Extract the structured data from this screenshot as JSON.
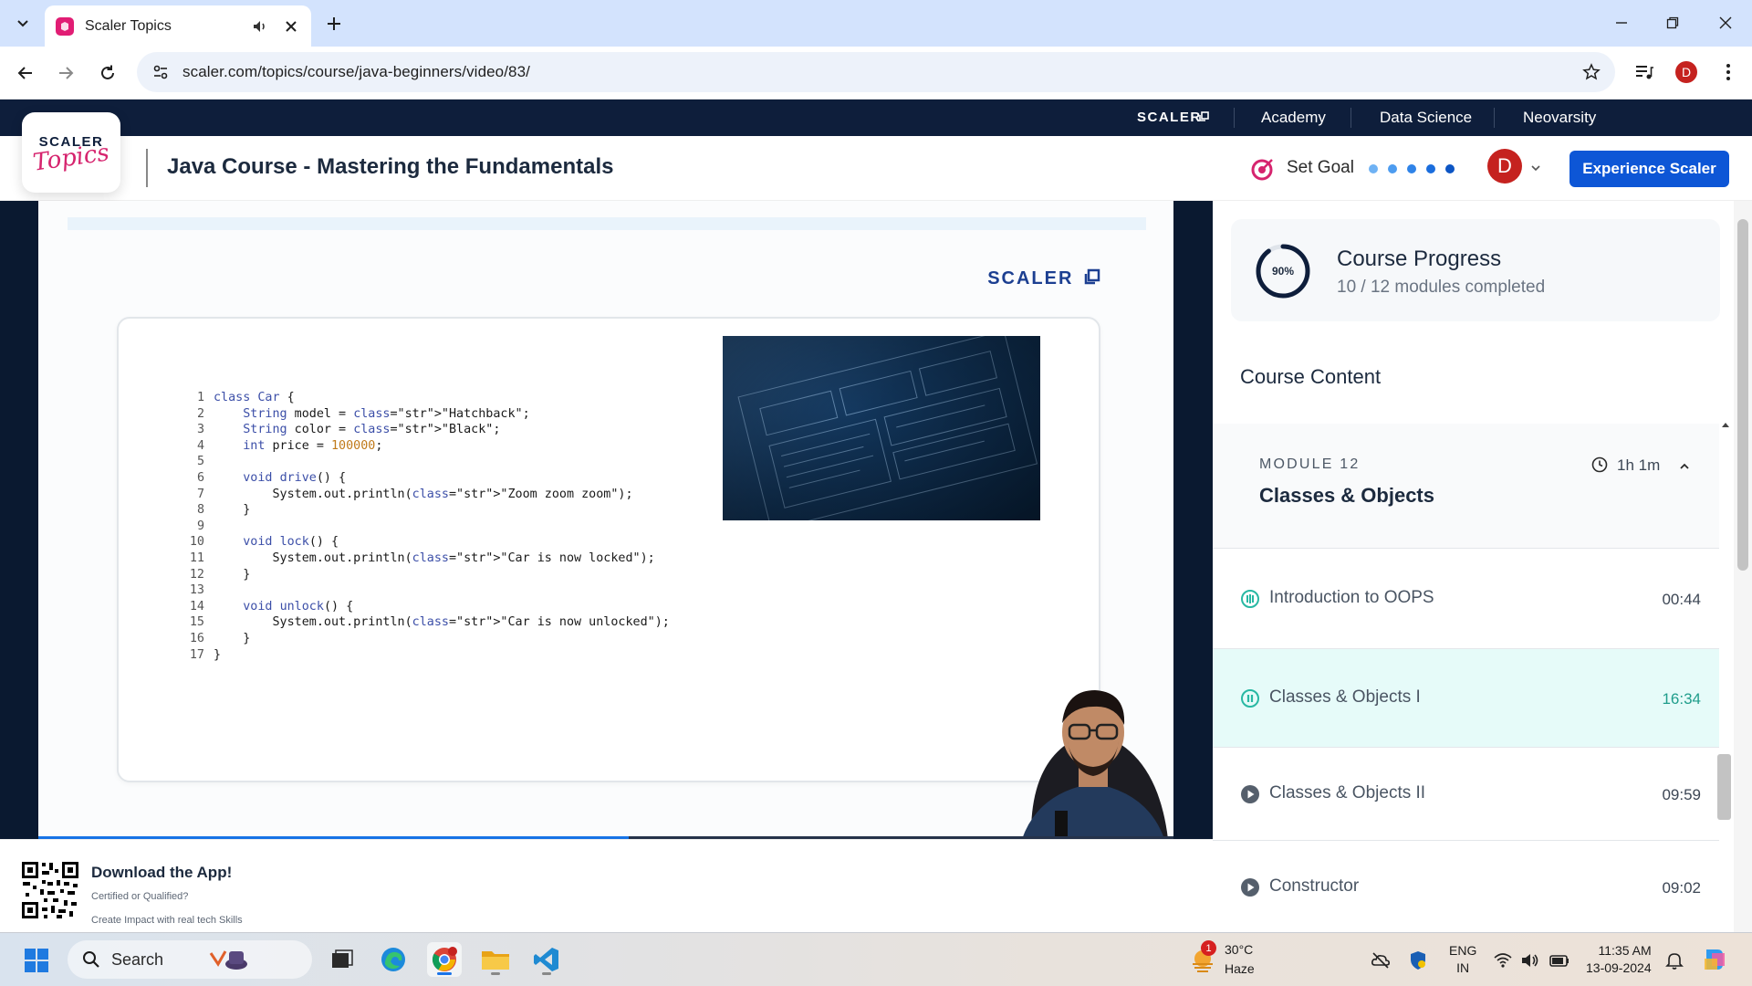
{
  "browser": {
    "tab_title": "Scaler Topics",
    "url": "scaler.com/topics/course/java-beginners/video/83/",
    "profile_initial": "D"
  },
  "topnav": {
    "brand": "SCALER",
    "links": [
      "Academy",
      "Data Science",
      "Neovarsity"
    ]
  },
  "header": {
    "logo_top": "SCALER",
    "logo_bottom": "Topics",
    "course_title": "Java Course - Mastering the Fundamentals",
    "set_goal": "Set Goal",
    "avatar_initial": "D",
    "cta": "Experience Scaler",
    "accent_color": "#0d56d6"
  },
  "slide": {
    "logo": "SCALER",
    "code_lines": [
      [
        "1",
        "class Car {"
      ],
      [
        "2",
        "    String model = \"Hatchback\";"
      ],
      [
        "3",
        "    String color = \"Black\";"
      ],
      [
        "4",
        "    int price = 100000;"
      ],
      [
        "5",
        ""
      ],
      [
        "6",
        "    void drive() {"
      ],
      [
        "7",
        "        System.out.println(\"Zoom zoom zoom\");"
      ],
      [
        "8",
        "    }"
      ],
      [
        "9",
        ""
      ],
      [
        "10",
        "    void lock() {"
      ],
      [
        "11",
        "        System.out.println(\"Car is now locked\");"
      ],
      [
        "12",
        "    }"
      ],
      [
        "13",
        ""
      ],
      [
        "14",
        "    void unlock() {"
      ],
      [
        "15",
        "        System.out.println(\"Car is now unlocked\");"
      ],
      [
        "16",
        "    }"
      ],
      [
        "17",
        "}"
      ]
    ],
    "playback_progress": 0.52
  },
  "sidebar": {
    "progress_percent_label": "90%",
    "progress_fraction": 0.9,
    "progress_title": "Course Progress",
    "progress_sub": "10 / 12 modules completed",
    "content_title": "Course Content",
    "module": {
      "label": "MODULE 12",
      "name": "Classes & Objects",
      "duration": "1h 1m"
    },
    "lessons": [
      {
        "name": "Introduction to OOPS",
        "time": "00:44",
        "state": "done"
      },
      {
        "name": "Classes & Objects I",
        "time": "16:34",
        "state": "active"
      },
      {
        "name": "Classes & Objects II",
        "time": "09:59",
        "state": "pending"
      },
      {
        "name": "Constructor",
        "time": "09:02",
        "state": "pending"
      }
    ]
  },
  "app_banner": {
    "title": "Download the App!",
    "line1": "Certified or Qualified?",
    "line2": "Create Impact with real tech Skills"
  },
  "taskbar": {
    "search": "Search",
    "weather_badge": "1",
    "temperature": "30°C",
    "weather": "Haze",
    "lang1": "ENG",
    "lang2": "IN",
    "time": "11:35 AM",
    "date": "13-09-2024"
  }
}
